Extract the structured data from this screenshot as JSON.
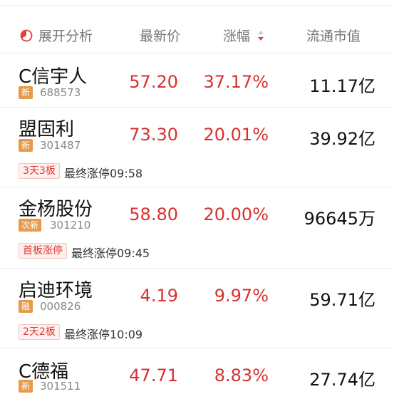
{
  "header": {
    "analysis_label": "展开分析",
    "price_label": "最新价",
    "change_label": "涨幅",
    "cap_label": "流通市值"
  },
  "colors": {
    "rise": "#d8302f",
    "badge": "#e79a4a",
    "tag_text": "#e03a30"
  },
  "stocks": [
    {
      "name": "C信宇人",
      "badge": "新",
      "code": "688573",
      "price": "57.20",
      "change": "37.17%",
      "cap": "11.17亿"
    },
    {
      "name": "盟固利",
      "badge": "新",
      "code": "301487",
      "price": "73.30",
      "change": "20.01%",
      "cap": "39.92亿",
      "tag": "3天3板",
      "tag_note": "最终涨停09:58"
    },
    {
      "name": "金杨股份",
      "badge": "次新",
      "code": "301210",
      "price": "58.80",
      "change": "20.00%",
      "cap": "96645万",
      "tag": "首板涨停",
      "tag_note": "最终涨停09:45"
    },
    {
      "name": "启迪环境",
      "badge": "融",
      "code": "000826",
      "price": "4.19",
      "change": "9.97%",
      "cap": "59.71亿",
      "tag": "2天2板",
      "tag_note": "最终涨停10:09"
    },
    {
      "name": "C德福",
      "badge": "新",
      "code": "301511",
      "price": "47.71",
      "change": "8.83%",
      "cap": "27.74亿"
    }
  ]
}
